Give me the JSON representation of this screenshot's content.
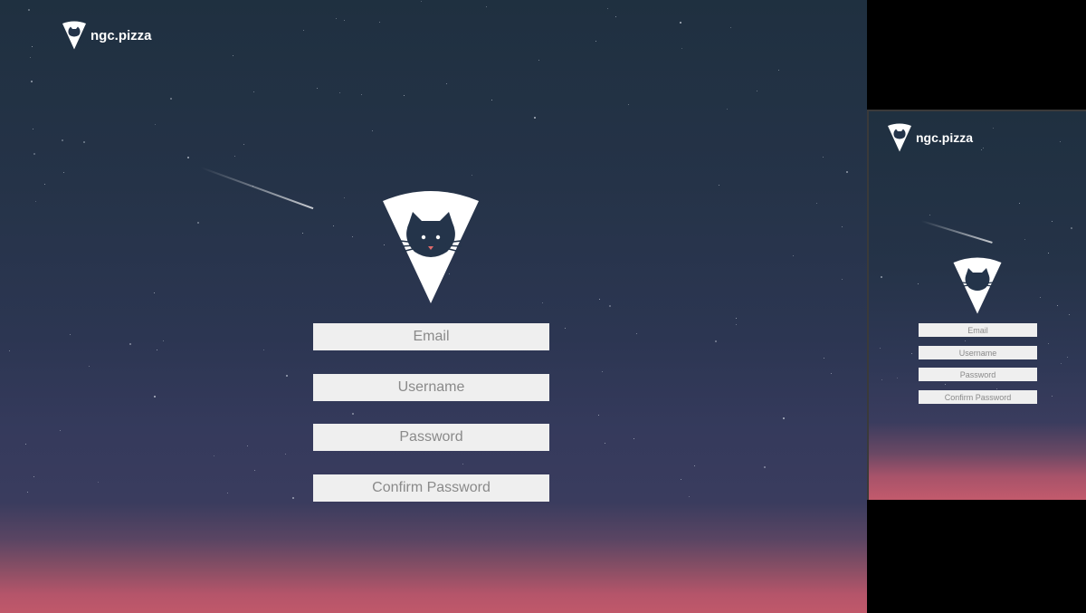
{
  "brand": {
    "name": "ngc.pizza"
  },
  "icons": {
    "logo": "pizza-slice-cat-icon"
  },
  "colors": {
    "field_bg": "#efefef",
    "placeholder": "#8a8a8a",
    "sky_top": "#1f3040",
    "sky_bottom": "#c0586a"
  },
  "form": {
    "email_placeholder": "Email",
    "username_placeholder": "Username",
    "password_placeholder": "Password",
    "confirm_password_placeholder": "Confirm Password"
  }
}
